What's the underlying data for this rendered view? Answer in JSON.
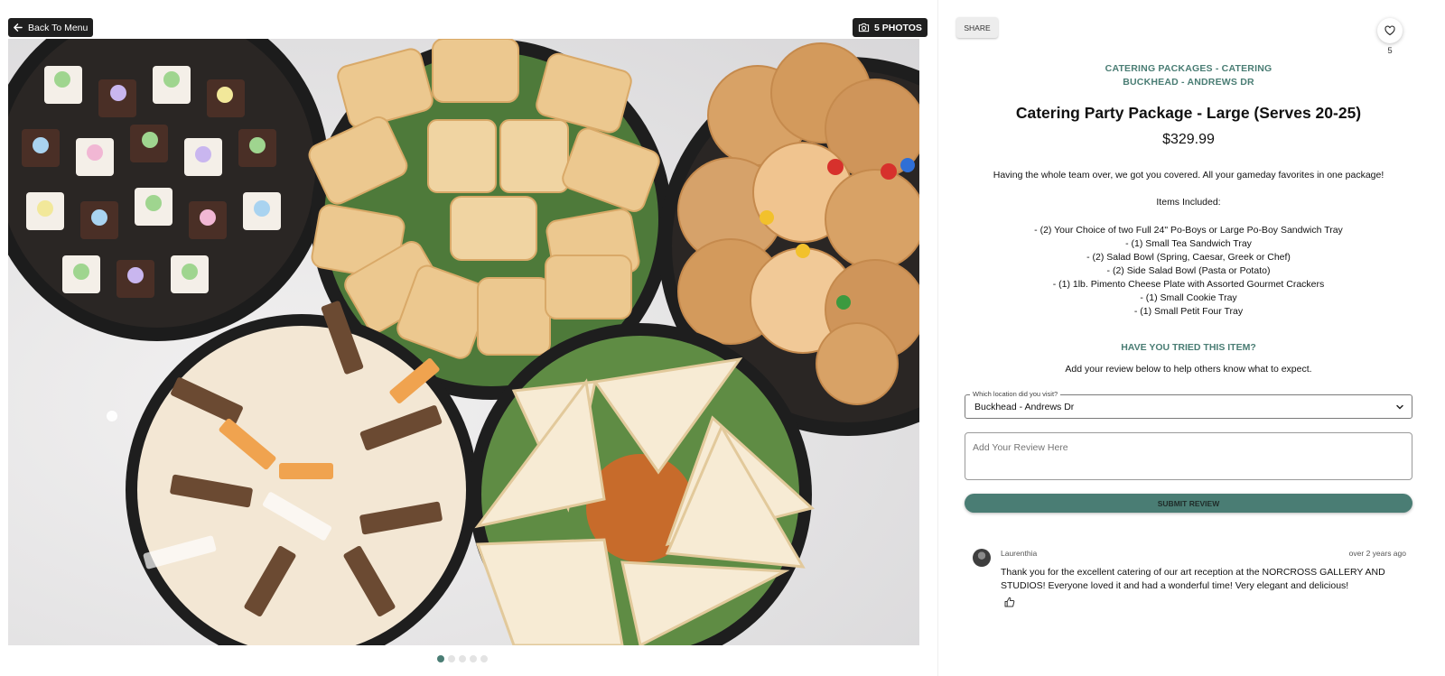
{
  "gallery": {
    "back_label": "Back To Menu",
    "photos_label": "5 PHOTOS",
    "photo_count": 5,
    "active_index": 0
  },
  "panel": {
    "share_label": "SHARE",
    "favorite_count": "5",
    "breadcrumb": [
      "CATERING PACKAGES - CATERING",
      "BUCKHEAD - ANDREWS DR"
    ],
    "title": "Catering Party Package - Large (Serves 20-25)",
    "price": "$329.99",
    "description": "Having the whole team over, we got you covered. All your gameday favorites in one package!",
    "items_heading": "Items Included:",
    "items": [
      "- (2) Your Choice of two Full 24\" Po-Boys or Large Po-Boy Sandwich Tray",
      "- (1) Small Tea Sandwich Tray",
      "- (2) Salad Bowl (Spring, Caesar, Greek or Chef)",
      "- (2) Side Salad Bowl (Pasta or Potato)",
      "- (1) 1lb. Pimento Cheese Plate with Assorted Gourmet Crackers",
      "- (1) Small Cookie Tray",
      "- (1) Small Petit Four Tray"
    ],
    "tried_heading": "HAVE YOU TRIED THIS ITEM?",
    "tried_sub": "Add your review below to help others know what to expect.",
    "location_label": "Which location did you visit?",
    "location_value": "Buckhead - Andrews Dr",
    "review_placeholder": "Add Your Review Here",
    "submit_label": "SUBMIT REVIEW",
    "review": {
      "author": "Laurenthia",
      "time": "over 2 years ago",
      "text": "Thank you for the excellent catering of our art reception at the NORCROSS GALLERY AND STUDIOS! Everyone loved it and had a wonderful time! Very elegant and delicious!"
    }
  },
  "colors": {
    "accent": "#4a7d74",
    "dark_button": "#1f1f1f"
  },
  "icons": [
    "arrow-left-icon",
    "camera-icon",
    "heart-icon",
    "chevron-down-icon",
    "thumbs-up-icon"
  ]
}
